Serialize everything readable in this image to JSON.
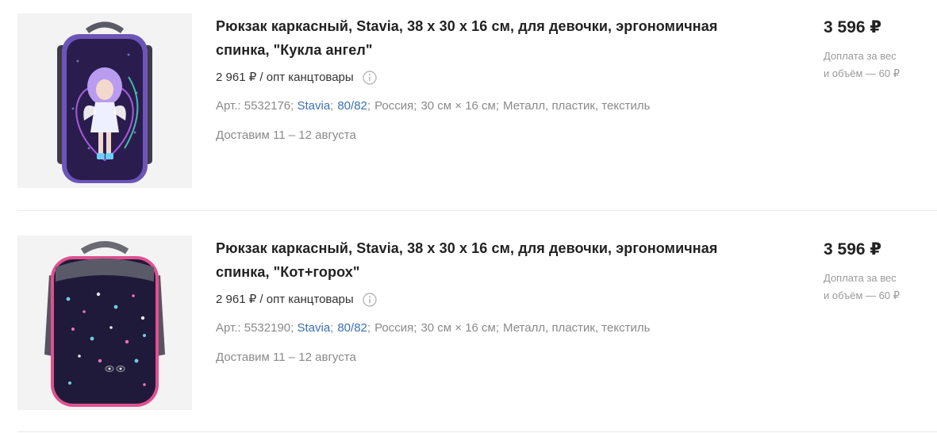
{
  "products": [
    {
      "title_line1": "Рюкзак каркасный, Stavia, 38 х 30 х 16 см, для девочки, эргономичная",
      "title_line2": "спинка, \"Кукла ангел\"",
      "wholesale": "2 961 ₽ / опт канцтовары",
      "art_label": "Арт.: 5532176;",
      "brand": "Stavia",
      "pack": "80/82",
      "country": "Россия",
      "size": "30 см × 16 см",
      "material": "Металл, пластик, текстиль",
      "delivery": "Доставим 11 – 12 августа",
      "price": "3 596 ₽",
      "surcharge_line1": "Доплата за вес",
      "surcharge_line2": "и объём — 60 ₽",
      "image": "backpack-doll-angel-image"
    },
    {
      "title_line1": "Рюкзак каркасный, Stavia, 38 х 30 х 16 см, для девочки, эргономичная",
      "title_line2": "спинка, \"Кот+горох\"",
      "wholesale": "2 961 ₽ / опт канцтовары",
      "art_label": "Арт.: 5532190;",
      "brand": "Stavia",
      "pack": "80/82",
      "country": "Россия",
      "size": "30 см × 16 см",
      "material": "Металл, пластик, текстиль",
      "delivery": "Доставим 11 – 12 августа",
      "price": "3 596 ₽",
      "surcharge_line1": "Доплата за вес",
      "surcharge_line2": "и объём — 60 ₽",
      "image": "backpack-cat-peas-image"
    }
  ],
  "colors": {
    "link": "#3a6fb6",
    "muted": "#8a8a8a",
    "backpack1_body": "#2a1d4e",
    "backpack2_body": "#1f1a3a",
    "backpack2_trim": "#e0508f"
  }
}
